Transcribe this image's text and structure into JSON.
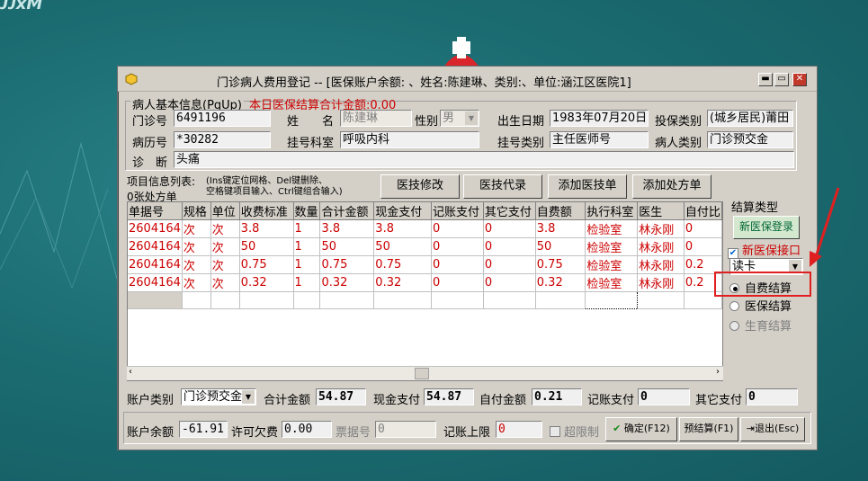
{
  "desktop": {
    "logo_text": "ᴊᴊxM"
  },
  "window": {
    "title": "门诊病人费用登记 -- [医保账户余额: 、姓名:陈建琳、类别:、单位:涵江区医院1]",
    "min": "▬",
    "max": "▭",
    "close": "✕"
  },
  "basic": {
    "group_title": "病人基本信息(PgUp)",
    "settle_label": "本日医保结算合计金额:0.00",
    "clinic_no_label": "门诊号",
    "clinic_no": "6491196",
    "name_label": "姓　　名",
    "name": "陈建琳",
    "gender_label": "性别",
    "gender": "男",
    "birth_label": "出生日期",
    "birth": "1983年07月20日",
    "ins_type_label": "投保类别",
    "ins_type": "(城乡居民)莆田",
    "record_no_label": "病历号",
    "record_no": "*30282",
    "dept_label": "挂号科室",
    "dept": "呼吸内科",
    "reg_type_label": "挂号类别",
    "reg_type": "主任医师号",
    "patient_type_label": "病人类别",
    "patient_type": "门诊预交金",
    "diag_label": "诊　断",
    "diag": "头痛"
  },
  "items": {
    "list_label_1": "项目信息列表:",
    "hint_1": "(Ins键定位网格、Del键删除、",
    "hint_2": "空格键项目输入、Ctrl键组合输入)",
    "list_label_2": "0张处方单",
    "btn_modify": "医技修改",
    "btn_proxy": "医技代录",
    "btn_add_tech": "添加医技单",
    "btn_add_rx": "添加处方单"
  },
  "grid": {
    "columns": [
      "单据号",
      "规格",
      "单位",
      "收费标准",
      "数量",
      "合计金额",
      "现金支付",
      "记账支付",
      "其它支付",
      "自费额",
      "执行科室",
      "医生",
      "自付比"
    ],
    "rows": [
      [
        "2604164",
        "次",
        "次",
        "3.8",
        "1",
        "3.8",
        "3.8",
        "0",
        "0",
        "3.8",
        "检验室",
        "林永刚",
        "0"
      ],
      [
        "2604164",
        "次",
        "次",
        "50",
        "1",
        "50",
        "50",
        "0",
        "0",
        "50",
        "检验室",
        "林永刚",
        "0"
      ],
      [
        "2604164",
        "次",
        "次",
        "0.75",
        "1",
        "0.75",
        "0.75",
        "0",
        "0",
        "0.75",
        "检验室",
        "林永刚",
        "0.2"
      ],
      [
        "2604164",
        "次",
        "次",
        "0.32",
        "1",
        "0.32",
        "0.32",
        "0",
        "0",
        "0.32",
        "检验室",
        "林永刚",
        "0.2"
      ]
    ]
  },
  "settle": {
    "title": "结算类型",
    "btn_login": "新医保登录",
    "chk_new_port": "新医保接口",
    "read_card": "读卡",
    "opt_self": "自费结算",
    "opt_ins": "医保结算",
    "opt_birth": "生育结算"
  },
  "totals": {
    "acct_type_label": "账户类别",
    "acct_type": "门诊预交金",
    "total_label": "合计金额",
    "total": "54.87",
    "cash_label": "现金支付",
    "cash": "54.87",
    "self_label": "自付金额",
    "self": "0.21",
    "charge_label": "记账支付",
    "charge": "0",
    "other_label": "其它支付",
    "other": "0"
  },
  "footer": {
    "balance_label": "账户余额",
    "balance": "-61.91",
    "allow_owe_label": "许可欠费",
    "allow_owe": "0.00",
    "receipt_label": "票据号",
    "receipt": "0",
    "limit_label": "记账上限",
    "limit": "0",
    "over_limit": "超限制",
    "btn_ok": "确定(F12)",
    "btn_pre": "预结算(F1)",
    "btn_exit": "退出(Esc)"
  }
}
